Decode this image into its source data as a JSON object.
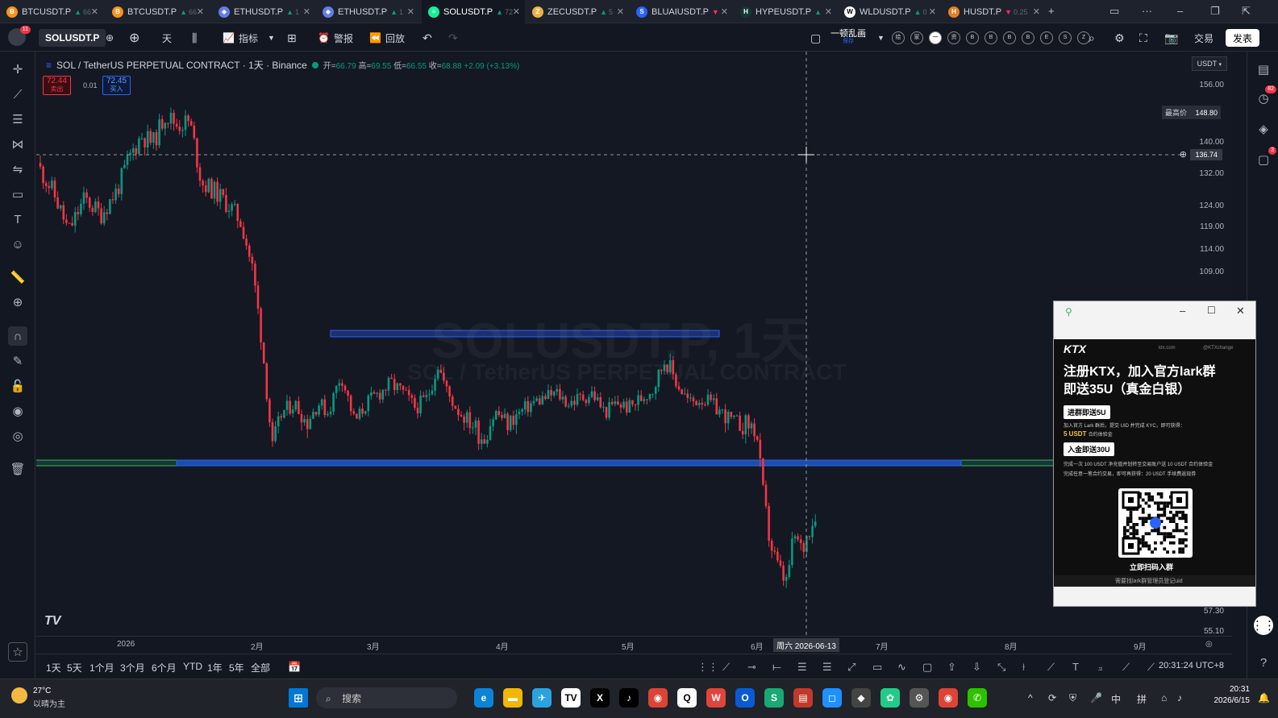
{
  "tabs": [
    {
      "symbol": "BTCUSDT.P",
      "change": "66",
      "dir": "up",
      "icon_color": "#f7931a",
      "icon": "B"
    },
    {
      "symbol": "BTCUSDT.P",
      "change": "66",
      "dir": "up",
      "icon_color": "#f7931a",
      "icon": "B"
    },
    {
      "symbol": "ETHUSDT.P",
      "change": "1",
      "dir": "up",
      "icon_color": "#627eea",
      "icon": "◆"
    },
    {
      "symbol": "ETHUSDT.P",
      "change": "1",
      "dir": "up",
      "icon_color": "#627eea",
      "icon": "◆"
    },
    {
      "symbol": "SOLUSDT.P",
      "change": "72",
      "dir": "up",
      "icon_color": "#14f195",
      "icon": "≡"
    },
    {
      "symbol": "ZECUSDT.P",
      "change": "5",
      "dir": "up",
      "icon_color": "#ecb244",
      "icon": "Z"
    },
    {
      "symbol": "BLUAIUSDT.P",
      "change": "",
      "dir": "dn",
      "icon_color": "#2962ff",
      "icon": "S"
    },
    {
      "symbol": "HYPEUSDT.P",
      "change": "",
      "dir": "up",
      "icon_color": "#0f3a34",
      "icon": "H"
    },
    {
      "symbol": "WLDUSDT.P",
      "change": "0",
      "dir": "up",
      "icon_color": "#ffffff",
      "icon": "W"
    },
    {
      "symbol": "HUSDT.P",
      "change": "0.25",
      "dir": "dn",
      "icon_color": "#e67e22",
      "icon": "H"
    }
  ],
  "active_tab_index": 4,
  "toolbar": {
    "avatar_badge": "11",
    "symbol": "SOLUSDT.P",
    "interval": "天",
    "indicators": "指标",
    "alerts": "警报",
    "replay": "回放",
    "layout_name": "一顿乱画",
    "layout_sub": "保存",
    "trade": "交易",
    "publish": "发表",
    "circle_letters": [
      "绘",
      "家",
      "一",
      "资",
      "B",
      "B",
      "B",
      "B",
      "E",
      "S",
      "Z"
    ]
  },
  "legend": {
    "title": "SOL / TetherUS PERPETUAL CONTRACT · 1天 · Binance",
    "open_label": "开=",
    "open": "66.79",
    "high_label": "高=",
    "high": "69.55",
    "low_label": "低=",
    "low": "66.55",
    "close_label": "收=",
    "close": "68.88",
    "change": "+2.09 (+3.13%)",
    "bid_price": "72.44",
    "bid_label": "卖出",
    "spread": "0.01",
    "ask_price": "72.45",
    "ask_label": "买入"
  },
  "watermark": {
    "main": "SOLUSDT.P, 1天",
    "sub": "SOL / TetherUS PERPETUAL CONTRACT"
  },
  "price_axis": {
    "currency": "USDT",
    "labels": [
      "156.00",
      "140.00",
      "132.00",
      "124.00",
      "119.00",
      "114.00",
      "109.00",
      "57.30",
      "55.10"
    ],
    "highest_label": "最高价",
    "highest_value": "148.80",
    "crosshair_value": "136.74"
  },
  "time_axis": {
    "labels": [
      "2026",
      "2月",
      "3月",
      "4月",
      "5月",
      "6月",
      "7月",
      "8月",
      "9月"
    ],
    "crosshair": "周六 2026-06-13"
  },
  "bottom": {
    "ranges": [
      "1天",
      "5天",
      "1个月",
      "3个月",
      "6个月",
      "YTD",
      "1年",
      "5年",
      "全部"
    ],
    "clock": "20:31:24 UTC+8"
  },
  "chart_data": {
    "type": "candlestick",
    "symbol": "SOLUSDT.P",
    "interval": "1天",
    "x": [
      "2026",
      "2月",
      "3月",
      "4月",
      "5月",
      "6月",
      "7月",
      "8月",
      "9月"
    ],
    "candles_approx": [
      {
        "period": "2026-01 early",
        "range": [
          119,
          140
        ]
      },
      {
        "period": "2026-01 mid",
        "range": [
          135,
          148.8
        ]
      },
      {
        "period": "2026-01 late",
        "range": [
          109,
          132
        ]
      },
      {
        "period": "2026-02",
        "range": [
          76,
          100
        ]
      },
      {
        "period": "2026-03",
        "range": [
          78,
          94
        ]
      },
      {
        "period": "2026-04",
        "range": [
          78,
          90
        ]
      },
      {
        "period": "2026-05",
        "range": [
          82,
          93
        ]
      },
      {
        "period": "2026-06",
        "range": [
          60,
          85
        ]
      }
    ],
    "up_color": "#089981",
    "down_color": "#f23645",
    "y_axis_labels": [
      "156.00",
      "140.00",
      "132.00",
      "124.00",
      "119.00",
      "114.00",
      "109.00",
      "57.30",
      "55.10"
    ],
    "highest": 148.8,
    "current": {
      "open": 66.79,
      "high": 69.55,
      "low": 66.55,
      "close": 68.88
    },
    "crosshair": {
      "price": 136.74,
      "date": "周六 2026-06-13"
    }
  },
  "popup": {
    "brand": "KTX",
    "site": "ktx.com",
    "handle": "@KTXchange",
    "headline1": "注册KTX，加入官方lark群",
    "headline2": "即送35U（真金白银）",
    "btn1": "进群即送5U",
    "desc1": "加入官方 Lark 群后，提交 UID 并完成 KYC，即可获得：",
    "desc1b": "5 USDT",
    "desc1c": "合约体验金",
    "btn2": "入金即送30U",
    "desc2": "完成一次 100 USDT 净充值并划转至交易账户送 10 USDT 合约体验金",
    "desc2b": "完成任意一笔合约交易，即可再获得：20 USDT 手续费返现券",
    "scan": "立即扫码入群",
    "footer": "需要找lark群管理员登记uid"
  },
  "taskbar": {
    "weather_temp": "27°C",
    "weather_desc": "以晴为主",
    "search": "搜索",
    "time": "20:31",
    "date": "2026/6/15",
    "ime1": "中",
    "ime2": "拼"
  },
  "colors": {
    "up": "#089981",
    "down": "#f23645",
    "bg": "#131722",
    "accent": "#2962ff"
  }
}
